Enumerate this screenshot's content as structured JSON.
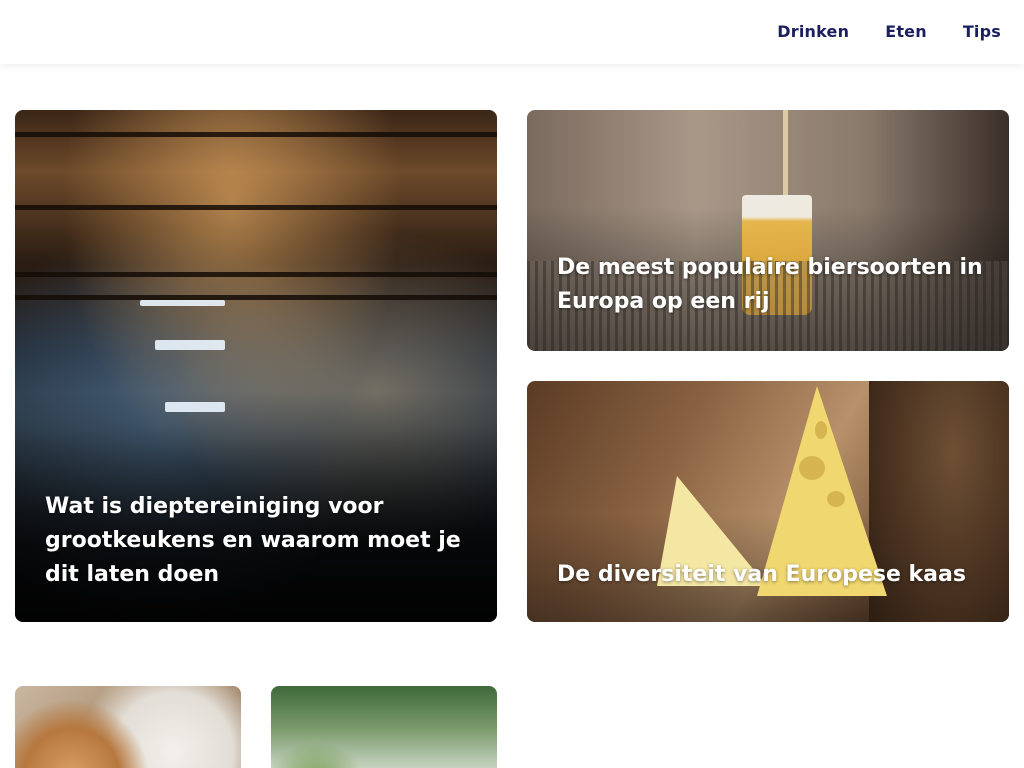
{
  "nav": {
    "items": [
      {
        "label": "Drinken"
      },
      {
        "label": "Eten"
      },
      {
        "label": "Tips"
      }
    ]
  },
  "cards": [
    {
      "title": "Wat is dieptereiniging voor grootkeukens en waarom moet je dit laten doen",
      "image": "restaurant-kitchen-photo"
    },
    {
      "title": "De meest populaire biersoorten in Europa op een rij",
      "image": "beer-glass-tap-photo"
    },
    {
      "title": "De diversiteit van Europese kaas",
      "image": "cheese-bread-photo"
    },
    {
      "title": "",
      "image": "pizza-recipe-book-photo"
    },
    {
      "title": "",
      "image": "pasta-basil-photo"
    }
  ]
}
